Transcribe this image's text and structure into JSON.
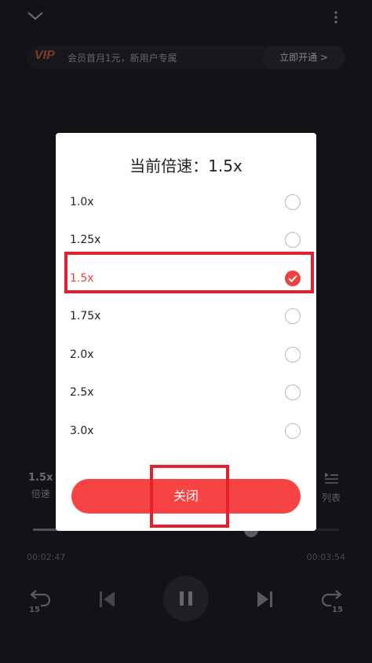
{
  "vip": {
    "logo": "VIP",
    "text": "会员首月1元，新用户专属",
    "button": "立即开通 >"
  },
  "player": {
    "speed_value": "1.5x",
    "speed_label": "倍速",
    "list_label": "列表",
    "current_time": "00:02:47",
    "total_time": "00:03:54",
    "progress_fraction": 0.712,
    "rewind_label": "15",
    "forward_label": "15"
  },
  "dialog": {
    "title": "当前倍速：1.5x",
    "options": [
      {
        "label": "1.0x",
        "selected": false
      },
      {
        "label": "1.25x",
        "selected": false
      },
      {
        "label": "1.5x",
        "selected": true
      },
      {
        "label": "1.75x",
        "selected": false
      },
      {
        "label": "2.0x",
        "selected": false
      },
      {
        "label": "2.5x",
        "selected": false
      },
      {
        "label": "3.0x",
        "selected": false
      }
    ],
    "close_label": "关闭"
  },
  "colors": {
    "accent": "#f74343",
    "selected_text": "#ef4040",
    "highlight_box": "#e5202e",
    "background": "#1c1c24"
  }
}
